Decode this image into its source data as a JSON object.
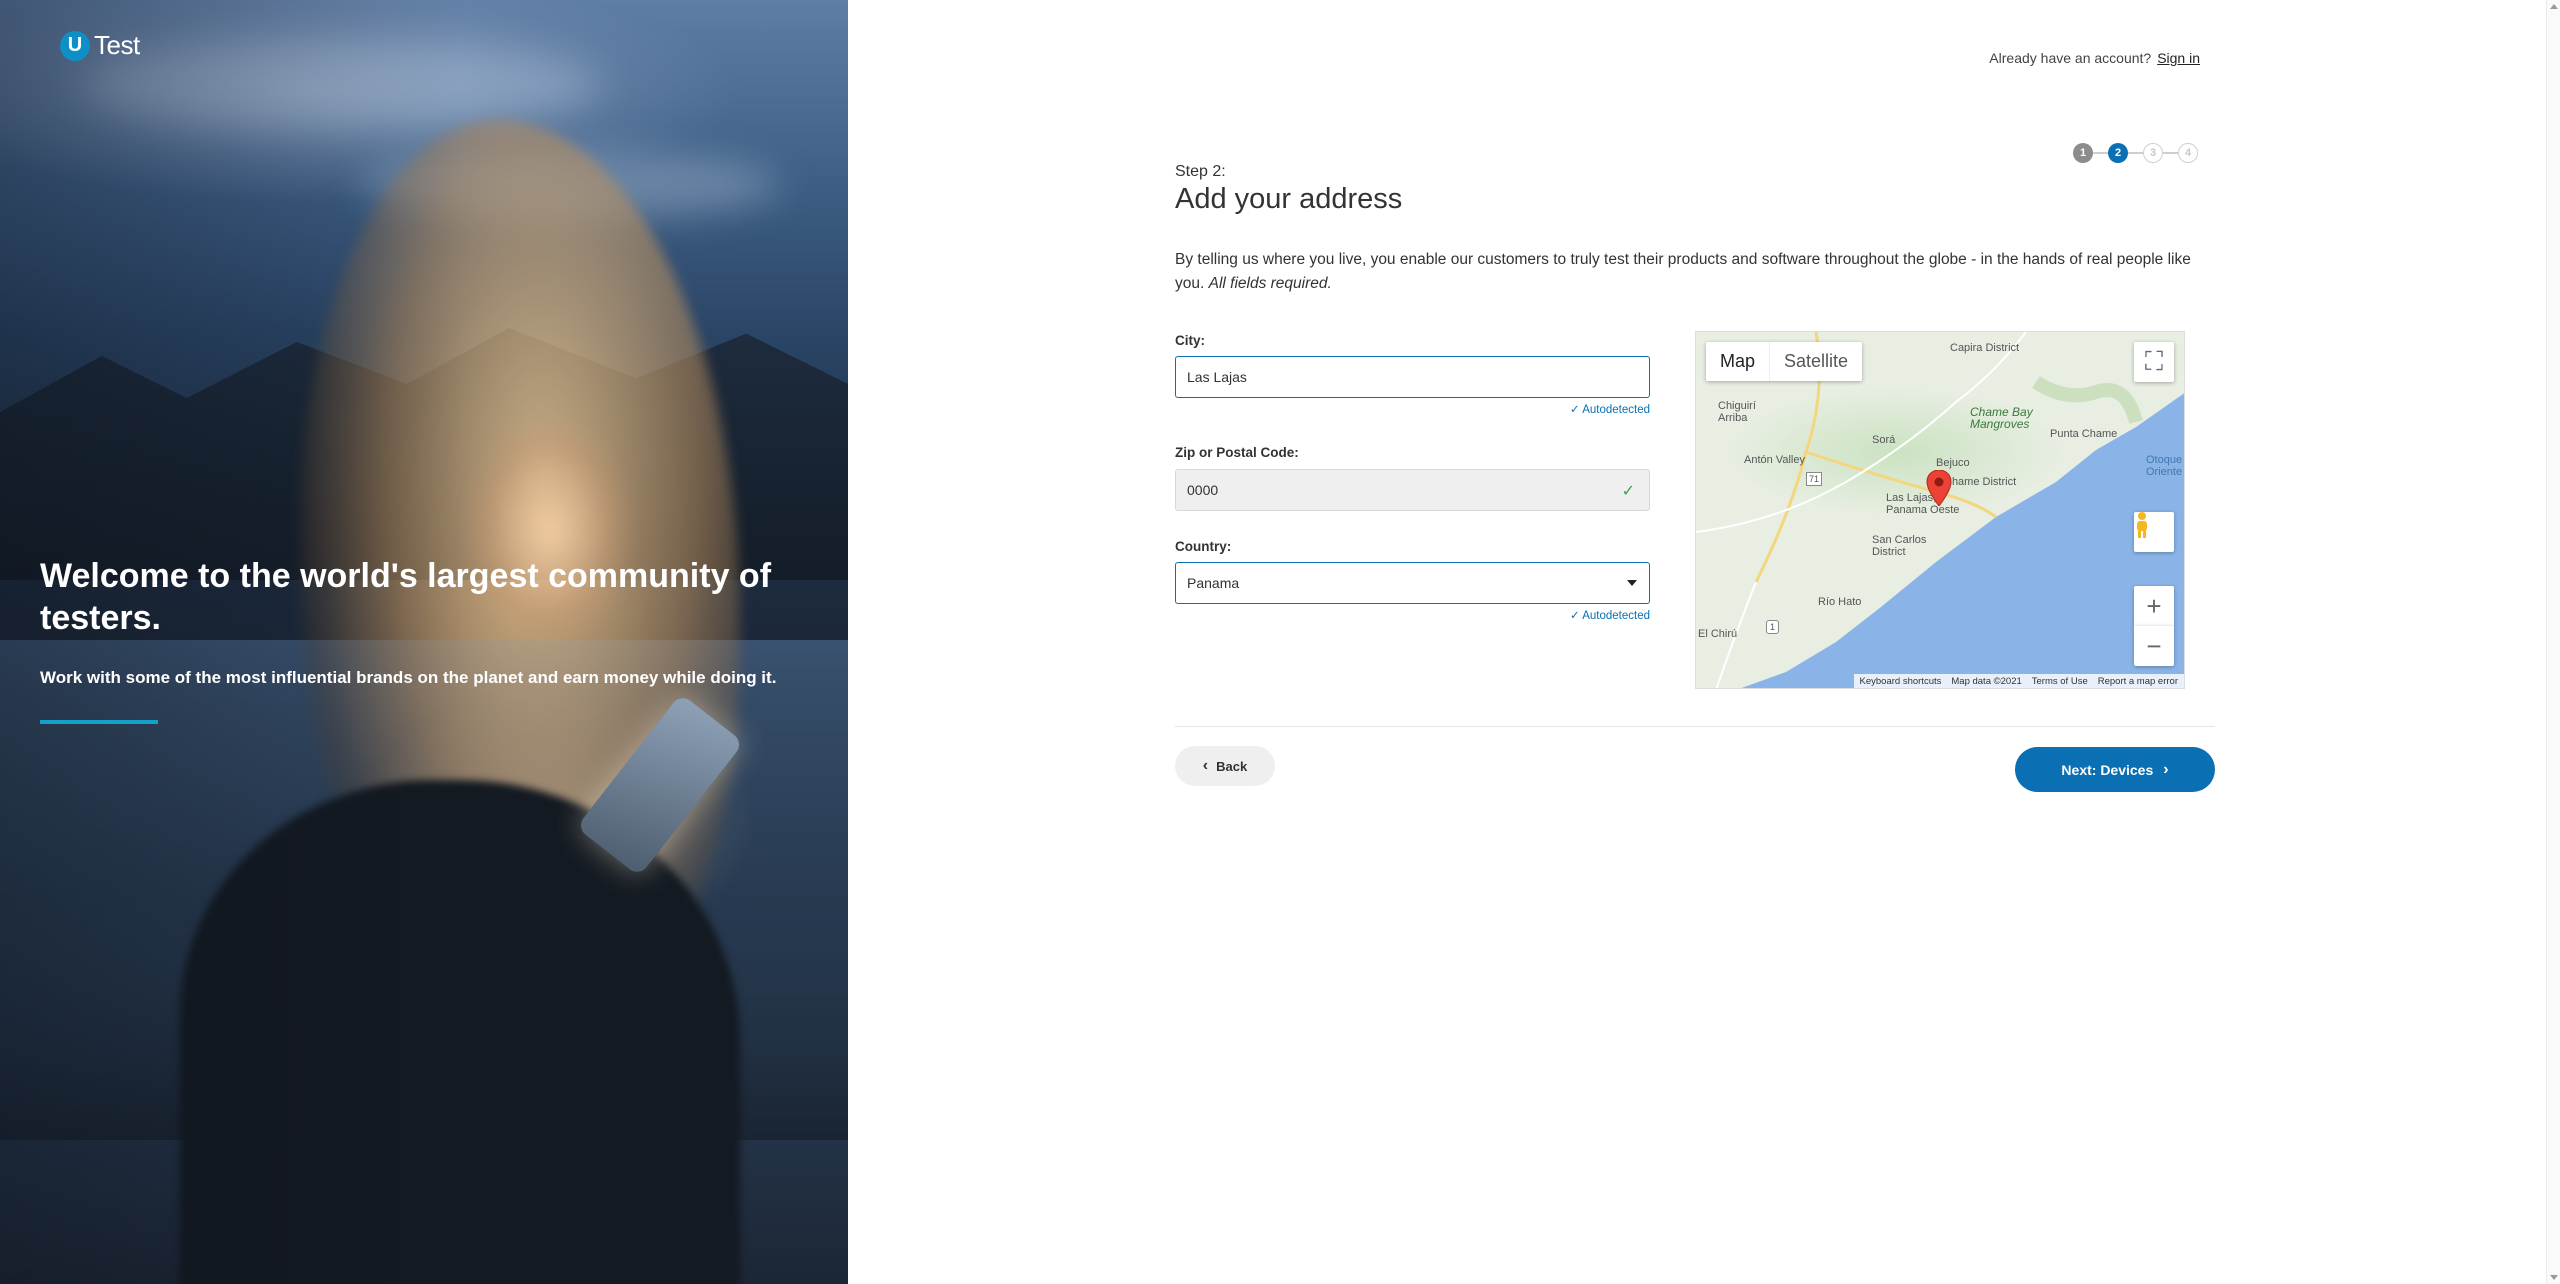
{
  "brand": {
    "logo_letter": "U",
    "logo_text": "Test",
    "accent": "#0b6fb3"
  },
  "hero": {
    "title": "Welcome to the world's largest community of testers.",
    "subtitle": "Work with some of the most influential brands on the planet and earn money while doing it."
  },
  "header": {
    "signin_prompt": "Already have an account?",
    "signin_link": "Sign in"
  },
  "stepper": {
    "steps": [
      "1",
      "2",
      "3",
      "4"
    ],
    "current": 2
  },
  "form": {
    "step_label": "Step 2:",
    "title": "Add your address",
    "intro": "By telling us where you live, you enable our customers to truly test their products and software throughout the globe - in the hands of real people like you.",
    "intro_emphasis": "All fields required.",
    "city": {
      "label": "City:",
      "value": "Las Lajas",
      "note": "✓ Autodetected"
    },
    "zip": {
      "label": "Zip or Postal Code:",
      "value": "0000"
    },
    "country": {
      "label": "Country:",
      "value": "Panama",
      "note": "✓ Autodetected"
    }
  },
  "map": {
    "type_map": "Map",
    "type_satellite": "Satellite",
    "labels": {
      "capira": "Capira District",
      "chiguiri": "Chiguirí\nArriba",
      "chame_bay": "Chame Bay\nMangroves",
      "punta_chame": "Punta Chame",
      "sora": "Sorá",
      "anton": "Antón Valley",
      "bejuco": "Bejuco",
      "otoque": "Otoque\nOriente",
      "chame_district": "Chame District",
      "las_lajas": "Las Lajas,\nPanama Oeste",
      "san_carlos": "San Carlos\nDistrict",
      "rio_hato": "Río Hato",
      "el_chiru": "El Chirú",
      "r71": "71",
      "r1": "1"
    },
    "footer": [
      "Keyboard shortcuts",
      "Map data ©2021",
      "Terms of Use",
      "Report a map error"
    ],
    "water_color": "#8ab4e8"
  },
  "actions": {
    "back": "Back",
    "next": "Next: Devices"
  }
}
